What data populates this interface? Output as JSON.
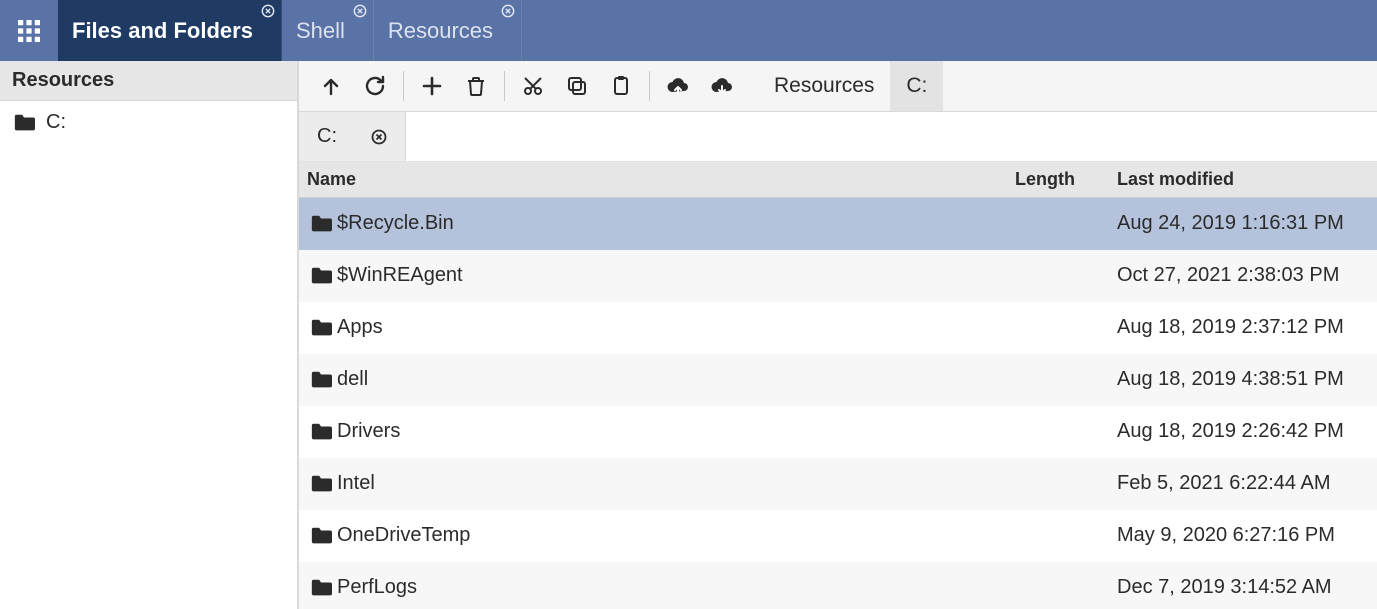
{
  "topbar": {
    "tabs": [
      {
        "label": "Files and Folders",
        "active": true
      },
      {
        "label": "Shell",
        "active": false
      },
      {
        "label": "Resources",
        "active": false
      }
    ]
  },
  "sidebar": {
    "title": "Resources",
    "tree": [
      {
        "label": "C:"
      }
    ]
  },
  "toolbar": {
    "crumbs": [
      {
        "label": "Resources",
        "active": false
      },
      {
        "label": "C:",
        "active": true
      }
    ]
  },
  "pathTabs": [
    {
      "label": "C:"
    }
  ],
  "table": {
    "headers": {
      "name": "Name",
      "length": "Length",
      "modified": "Last modified"
    },
    "rows": [
      {
        "name": "$Recycle.Bin",
        "length": "",
        "modified": "Aug 24, 2019 1:16:31 PM",
        "selected": true
      },
      {
        "name": "$WinREAgent",
        "length": "",
        "modified": "Oct 27, 2021 2:38:03 PM",
        "selected": false
      },
      {
        "name": "Apps",
        "length": "",
        "modified": "Aug 18, 2019 2:37:12 PM",
        "selected": false
      },
      {
        "name": "dell",
        "length": "",
        "modified": "Aug 18, 2019 4:38:51 PM",
        "selected": false
      },
      {
        "name": "Drivers",
        "length": "",
        "modified": "Aug 18, 2019 2:26:42 PM",
        "selected": false
      },
      {
        "name": "Intel",
        "length": "",
        "modified": "Feb 5, 2021 6:22:44 AM",
        "selected": false
      },
      {
        "name": "OneDriveTemp",
        "length": "",
        "modified": "May 9, 2020 6:27:16 PM",
        "selected": false
      },
      {
        "name": "PerfLogs",
        "length": "",
        "modified": "Dec 7, 2019 3:14:52 AM",
        "selected": false
      }
    ]
  }
}
